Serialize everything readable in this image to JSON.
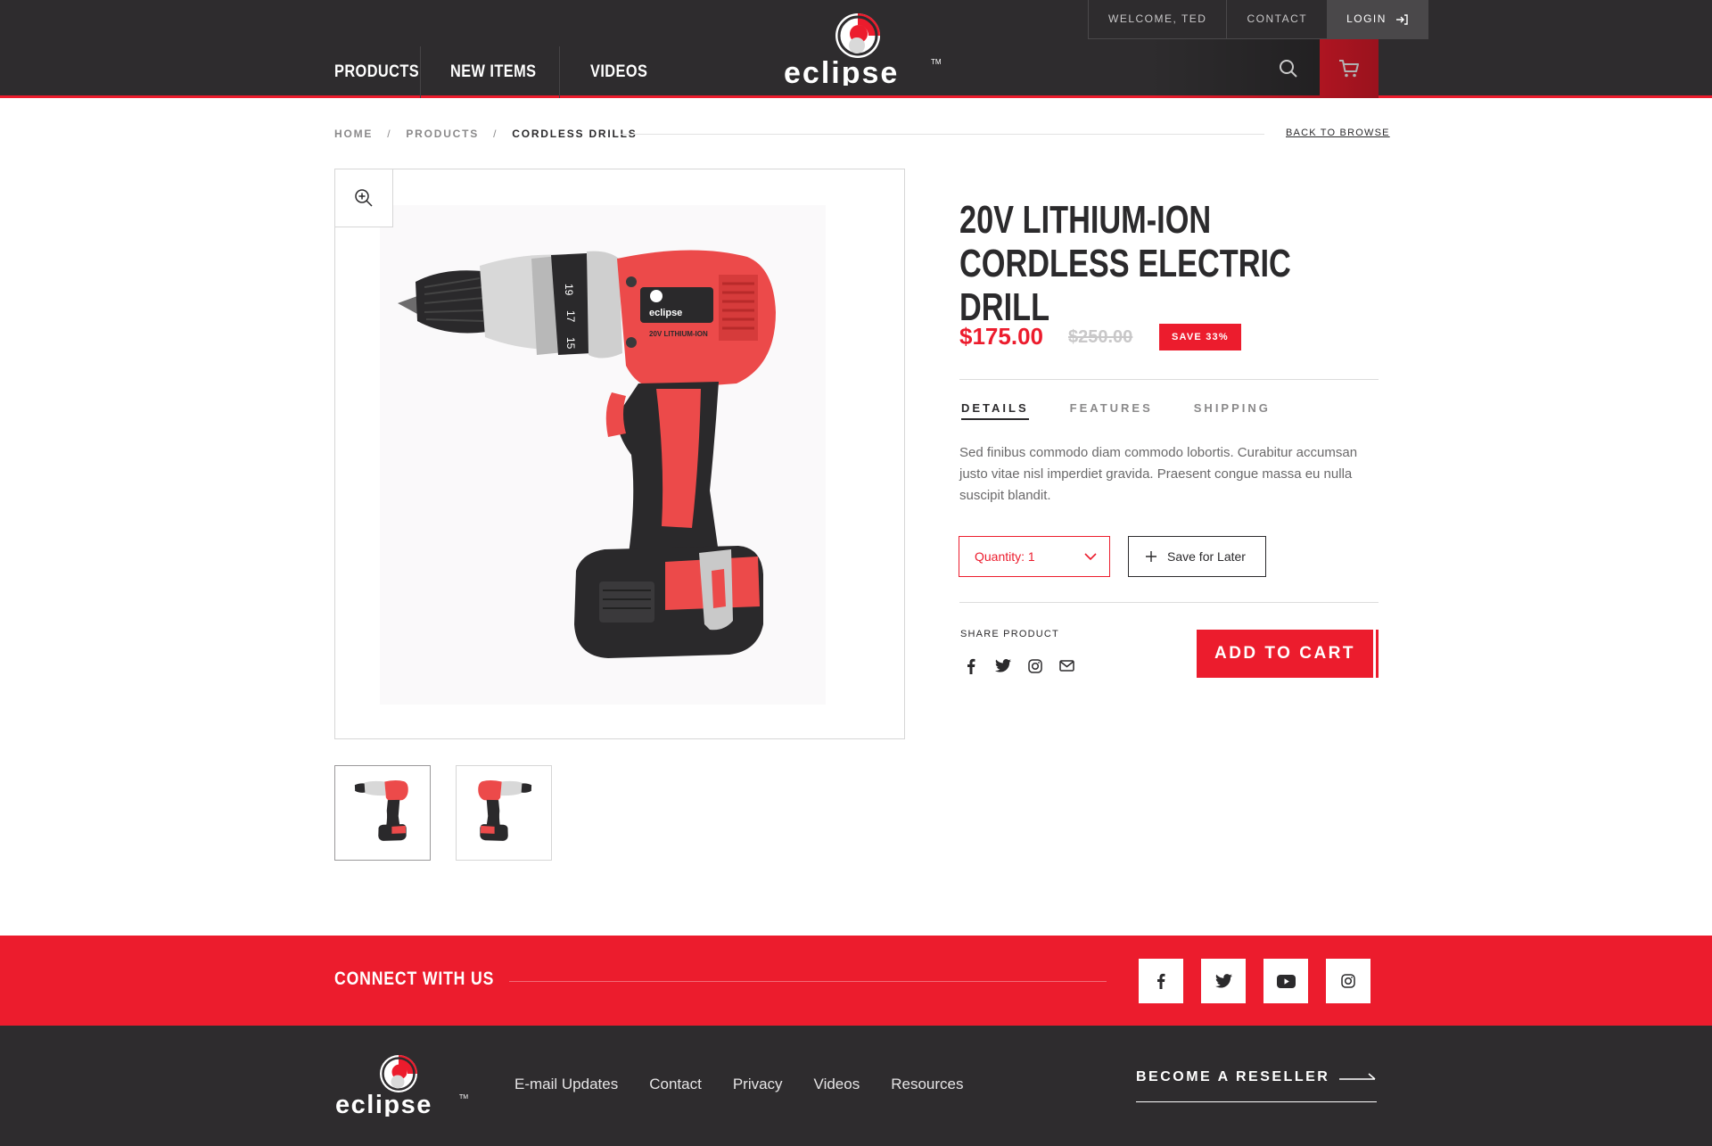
{
  "brand": {
    "name": "eclipse",
    "trademark": "TM",
    "accent_color": "#ec1c2d",
    "dark_color": "#2e2c2e"
  },
  "header": {
    "nav": [
      "PRODUCTS",
      "NEW ITEMS",
      "VIDEOS"
    ],
    "welcome": "WELCOME, TED",
    "contact": "CONTACT",
    "login": "LOGIN",
    "search_icon": "search-icon",
    "cart_icon": "cart-icon"
  },
  "breadcrumb": {
    "items": [
      "HOME",
      "PRODUCTS",
      "CORDLESS DRILLS"
    ],
    "separator": "/",
    "back_link": "BACK TO BROWSE"
  },
  "gallery": {
    "zoom_icon": "zoom-in-icon",
    "thumbnails": [
      "drill-thumbnail-1",
      "drill-thumbnail-2"
    ],
    "active_thumbnail": 0,
    "tool_label": "20V LITHIUM-ION",
    "clutch_numbers": [
      "15",
      "17",
      "19"
    ]
  },
  "product": {
    "title": "20V LITHIUM-ION CORDLESS ELECTRIC DRILL",
    "price": "$175.00",
    "old_price": "$250.00",
    "save_badge": "SAVE 33%",
    "tabs": [
      "DETAILS",
      "FEATURES",
      "SHIPPING"
    ],
    "active_tab": "DETAILS",
    "description": "Sed finibus commodo diam commodo lobortis. Curabitur accumsan justo vitae nisl imperdiet gravida. Praesent congue massa eu nulla suscipit blandit.",
    "quantity_label": "Quantity: 1",
    "save_for_later": "Save for Later",
    "share_label": "SHARE PRODUCT",
    "share_icons": [
      "facebook-icon",
      "twitter-icon",
      "instagram-icon",
      "email-icon"
    ],
    "add_to_cart": "ADD TO CART"
  },
  "connect": {
    "title": "CONNECT WITH US",
    "icons": [
      "facebook-icon",
      "twitter-icon",
      "youtube-icon",
      "instagram-icon"
    ]
  },
  "footer": {
    "links": [
      "E-mail Updates",
      "Contact",
      "Privacy",
      "Videos",
      "Resources"
    ],
    "reseller": "BECOME A RESELLER"
  }
}
